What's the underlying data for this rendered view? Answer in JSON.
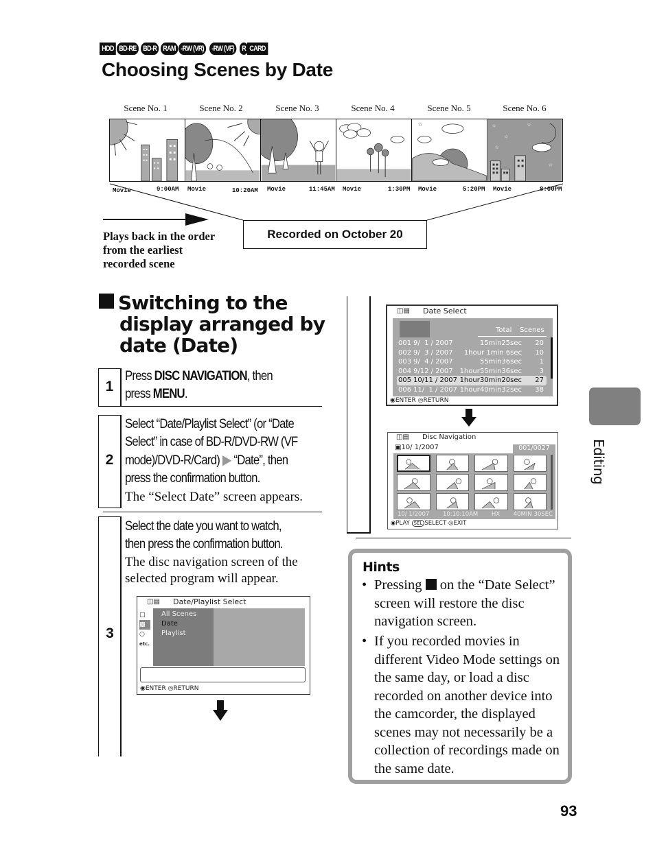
{
  "media_badges": [
    "HDD",
    "BD-RE",
    "BD-R",
    "RAM",
    "-RW (VR)",
    "-RW (VF)",
    "R",
    "CARD"
  ],
  "page_title": "Choosing Scenes by Date",
  "scenes": [
    {
      "label": "Scene No. 1",
      "type": "Movie",
      "time": "9:00AM"
    },
    {
      "label": "Scene No. 2",
      "type": "Movie",
      "time": "10:20AM"
    },
    {
      "label": "Scene No. 3",
      "type": "Movie",
      "time": "11:45AM"
    },
    {
      "label": "Scene No. 4",
      "type": "Movie",
      "time": "1:30PM"
    },
    {
      "label": "Scene No. 5",
      "type": "Movie",
      "time": "5:20PM"
    },
    {
      "label": "Scene No. 6",
      "type": "Movie",
      "time": "8:00PM"
    }
  ],
  "recorded_on": "Recorded on October 20",
  "playback_note": [
    "Plays back in the order",
    "from the earliest",
    "recorded scene"
  ],
  "section": {
    "heading": [
      "Switching to the",
      "display arranged by",
      "date (Date)"
    ]
  },
  "steps": [
    {
      "num": "1",
      "lines": [
        "Press ",
        "DISC NAVIGATION",
        ", then",
        "press ",
        "MENU",
        "."
      ]
    },
    {
      "num": "2",
      "lines": [
        "Select “Date/Playlist Select” (or “Date",
        "Select” in case of BD-R/DVD-RW (VF",
        "mode)/DVD-R/Card)",
        "“Date”, then",
        "press the confirmation button."
      ],
      "sub": "The “Select Date” screen appears."
    },
    {
      "num": "3",
      "lines": [
        "Select the date you want to watch,",
        "then press the confirmation button."
      ],
      "sub": [
        "The disc navigation screen of the",
        "selected program will appear."
      ]
    }
  ],
  "screen_playlist": {
    "title": "Date/Playlist Select",
    "items": [
      "All Scenes",
      "Date",
      "Playlist"
    ],
    "selected": "Date",
    "side_icon_etc": "etc.",
    "footer_enter": "ENTER",
    "footer_return": "RETURN"
  },
  "screen_date_select": {
    "title": "Date Select",
    "col_total": "Total",
    "col_scenes": "Scenes",
    "rows": [
      {
        "no": "001",
        "date": "9/  1 / 2007",
        "total": "15min25sec",
        "scenes": "20"
      },
      {
        "no": "002",
        "date": "9/  3 / 2007",
        "total": "1hour 1min 6sec",
        "scenes": "10"
      },
      {
        "no": "003",
        "date": "9/  4 / 2007",
        "total": "55min36sec",
        "scenes": "1"
      },
      {
        "no": "004",
        "date": "9/12 / 2007",
        "total": "1hour55min36sec",
        "scenes": "3"
      },
      {
        "no": "005",
        "date": "10/11 / 2007",
        "total": "1hour30min20sec",
        "scenes": "27"
      },
      {
        "no": "006",
        "date": "11/  1 / 2007",
        "total": "1hour40min32sec",
        "scenes": "38"
      }
    ],
    "selected_row": "005",
    "footer_enter": "ENTER",
    "footer_return": "RETURN"
  },
  "screen_disc_nav": {
    "title": "Disc  Navigation",
    "date": "10/  1/2007",
    "counter": "001/0027",
    "status_date": "10/  1/2007",
    "status_time": "10:10:10AM",
    "status_mode": "HX",
    "status_duration": "40MIN 30SEC",
    "footer_play": "PLAY",
    "footer_sel": "SEL",
    "footer_select": "SELECT",
    "footer_exit": "EXIT"
  },
  "hints": {
    "title": "Hints",
    "items": [
      {
        "before": "Pressing ",
        "after_lines": [
          "on the “Date Select”",
          "screen will restore the disc",
          "navigation screen."
        ]
      },
      {
        "lines": [
          "If you recorded movies in",
          "different Video Mode settings on",
          "the same day, or load a disc",
          "recorded on another device into",
          "the camcorder, the displayed",
          "scenes may not necessarily be a",
          "collection of recordings made on",
          "the same date."
        ]
      }
    ]
  },
  "side_tab_label": "Editing",
  "page_number": "93"
}
